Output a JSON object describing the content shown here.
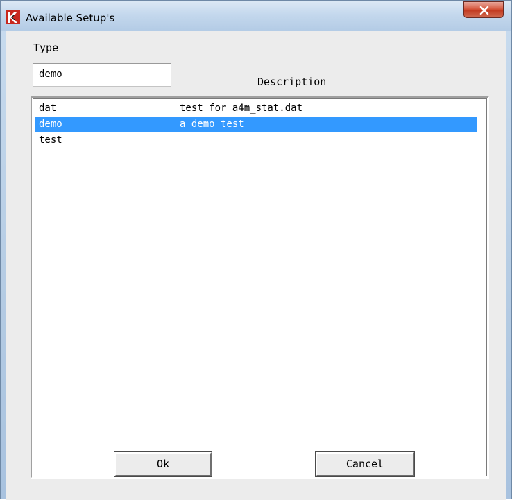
{
  "window": {
    "title": "Available Setup's",
    "close_icon": "close-x-icon",
    "app_icon": "app-logo-icon"
  },
  "form": {
    "type_label": "Type",
    "type_value": "demo",
    "description_header": "Description"
  },
  "list": {
    "rows": [
      {
        "type": "dat",
        "description": "test for a4m_stat.dat",
        "selected": false
      },
      {
        "type": "demo",
        "description": "a demo test",
        "selected": true
      },
      {
        "type": "test",
        "description": "",
        "selected": false
      }
    ]
  },
  "buttons": {
    "ok_label": "Ok",
    "cancel_label": "Cancel"
  },
  "colors": {
    "selection": "#3399ff",
    "selection_text": "#ffffff",
    "close_button": "#c94a31",
    "logo_red": "#c8281e"
  }
}
